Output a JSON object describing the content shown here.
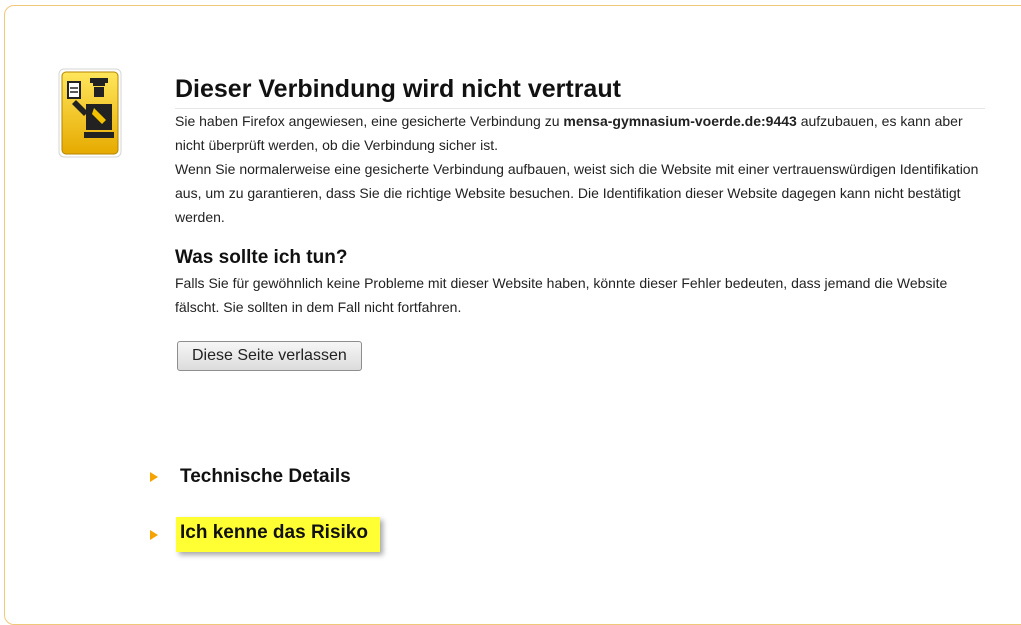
{
  "dialog": {
    "title": "Dieser Verbindung wird nicht vertraut",
    "para1_before": "Sie haben Firefox angewiesen, eine gesicherte Verbindung zu ",
    "host": "mensa-gymnasium-voerde.de:9443",
    "para1_after": " aufzubauen, es kann aber nicht überprüft werden, ob die Verbindung sicher ist.",
    "para2": "Wenn Sie normalerweise eine gesicherte Verbindung aufbauen, weist sich die Website mit einer vertrauenswürdigen Identifikation aus, um zu garantieren, dass Sie die richtige Website besuchen. Die Identifikation dieser Website dagegen kann nicht bestätigt werden.",
    "subtitle": "Was sollte ich tun?",
    "para3": "Falls Sie für gewöhnlich keine Probleme mit dieser Website haben, könnte dieser Fehler bedeuten, dass jemand die Website fälscht. Sie sollten in dem Fall nicht fortfahren.",
    "leave_button": "Diese Seite verlassen",
    "technical_details": "Technische Details",
    "understand_risks": "Ich kenne das Risiko"
  },
  "icons": {
    "main": "security-officer-icon",
    "expander": "triangle-right-icon"
  },
  "colors": {
    "icon_bg": "#f2c200",
    "arrow": "#f5a300",
    "highlight": "#ffff33",
    "frame_border": "#f0c87a"
  }
}
